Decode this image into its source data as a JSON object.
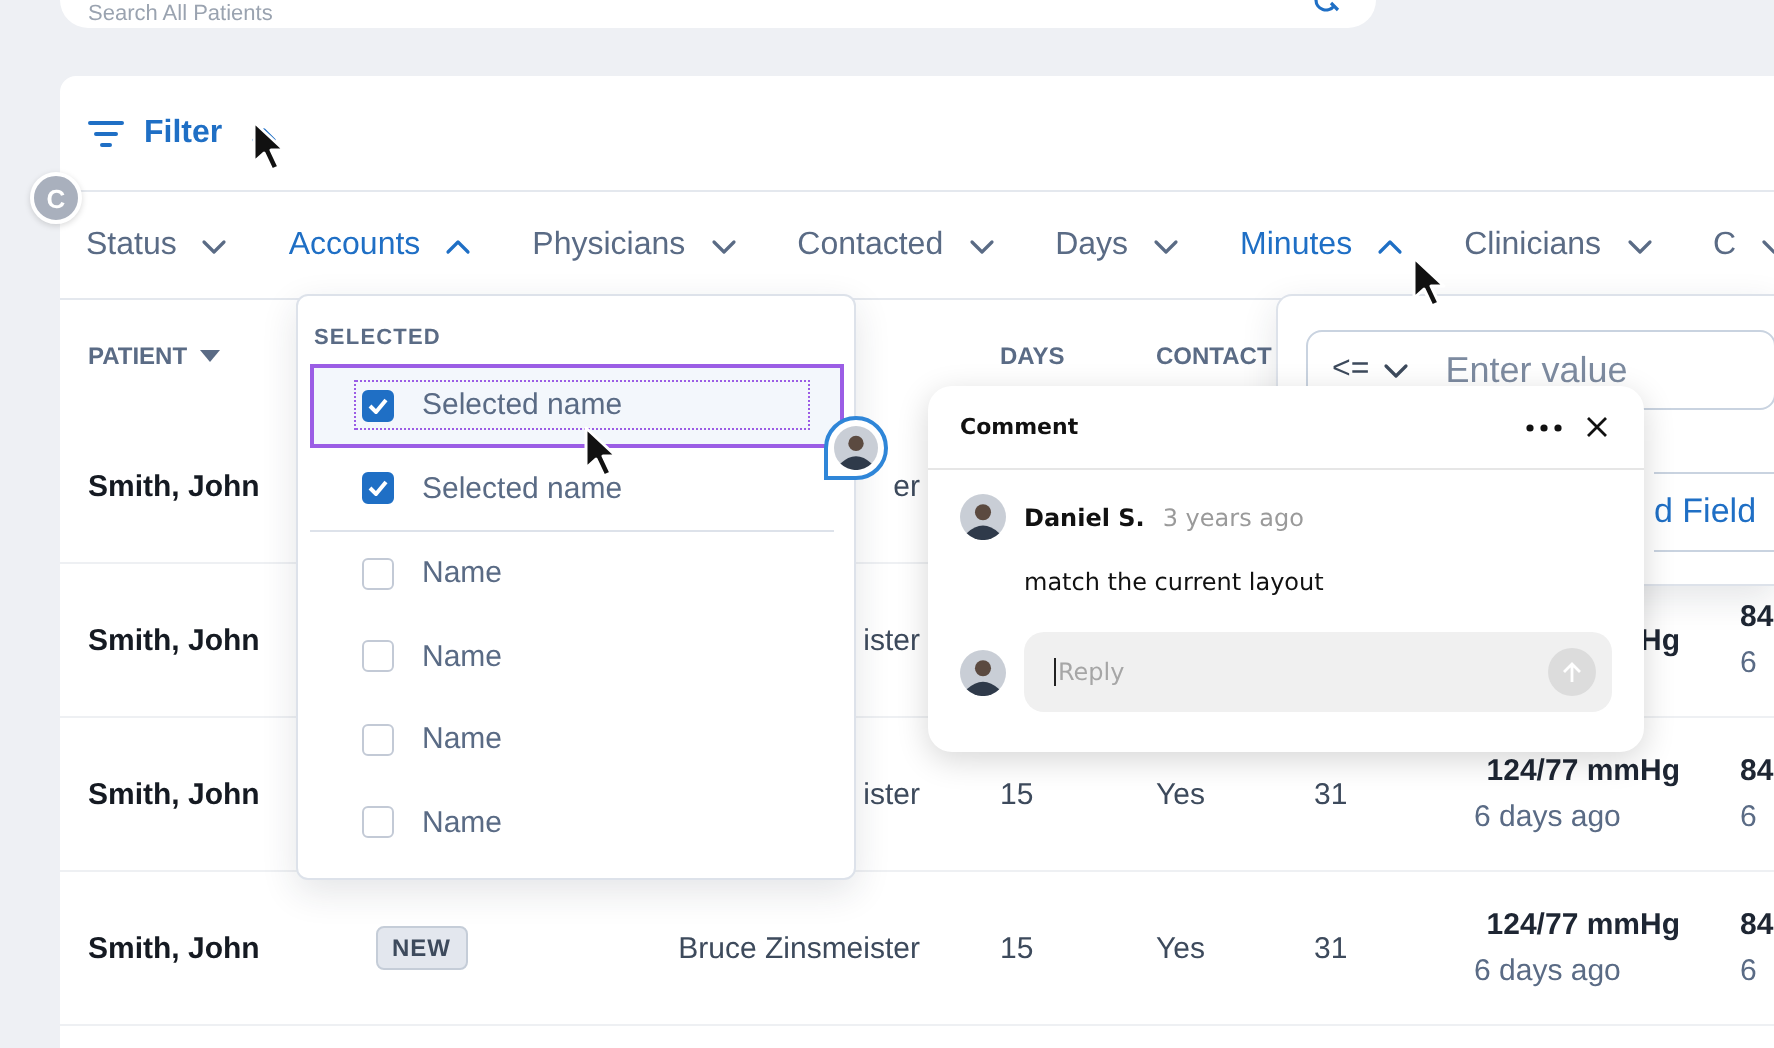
{
  "search": {
    "placeholder": "Search All Patients"
  },
  "filter": {
    "label": "Filter",
    "expanded": true
  },
  "filter_chips": [
    {
      "label": "Status",
      "expanded": false
    },
    {
      "label": "Accounts",
      "expanded": true
    },
    {
      "label": "Physicians",
      "expanded": false
    },
    {
      "label": "Contacted",
      "expanded": false
    },
    {
      "label": "Days",
      "expanded": false
    },
    {
      "label": "Minutes",
      "expanded": true
    },
    {
      "label": "Clinicians",
      "expanded": false
    },
    {
      "label": "C",
      "expanded": false
    }
  ],
  "collaborator": {
    "initial": "C"
  },
  "table": {
    "headers": {
      "patient": "PATIENT",
      "days": "DAYS",
      "contacted": "CONTACT"
    },
    "rows": [
      {
        "patient": "Smith, John",
        "physician": "er"
      },
      {
        "patient": "Smith, John",
        "physician": "ister",
        "blood_pressure": {
          "reading": "Hg"
        },
        "column_8": {
          "value": "84",
          "time": "6"
        }
      },
      {
        "patient": "Smith, John",
        "physician": "ister",
        "days": "15",
        "contacted": "Yes",
        "minutes": "31",
        "blood_pressure": {
          "reading": "124/77 mmHg",
          "time": "6 days ago"
        },
        "column_8": {
          "value": "84",
          "time": "6"
        }
      },
      {
        "patient": "Smith, John",
        "status": "NEW",
        "physician": "Bruce Zinsmeister",
        "days": "15",
        "contacted": "Yes",
        "minutes": "31",
        "blood_pressure": {
          "reading": "124/77 mmHg",
          "time": "6 days ago"
        },
        "column_8": {
          "value": "84",
          "time": "6"
        }
      }
    ]
  },
  "accounts_menu": {
    "section_label": "SELECTED",
    "selected_items": [
      {
        "label": "Selected name",
        "checked": true,
        "focused": true
      },
      {
        "label": "Selected name",
        "checked": true,
        "focused": false
      }
    ],
    "other_items": [
      {
        "label": "Name",
        "checked": false,
        "focused": false
      },
      {
        "label": "Name",
        "checked": false,
        "focused": false
      },
      {
        "label": "Name",
        "checked": false,
        "focused": false
      },
      {
        "label": "Name",
        "checked": false,
        "focused": false
      }
    ]
  },
  "minutes_menu": {
    "operator": "<=",
    "placeholder": "Enter value",
    "add_button": "d Field"
  },
  "comment": {
    "title": "Comment",
    "author": "Daniel S.",
    "time": "3 years ago",
    "text": "match the current layout",
    "reply_placeholder": "Reply"
  }
}
